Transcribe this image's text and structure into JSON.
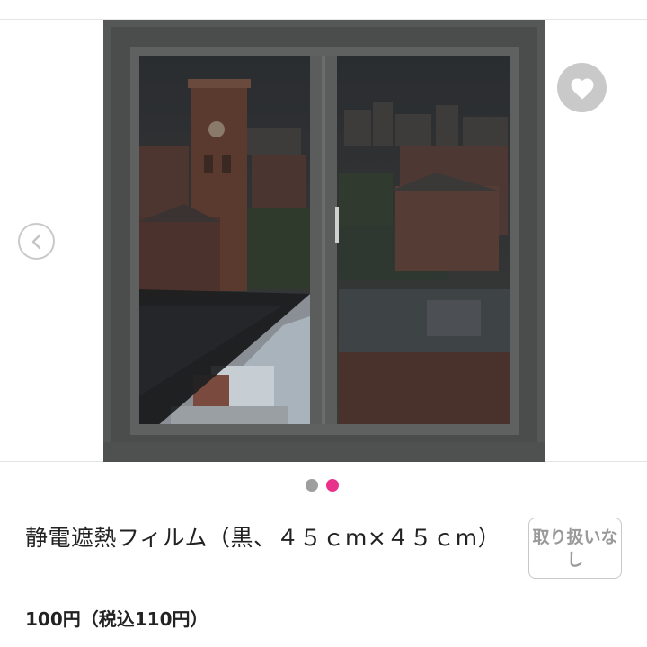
{
  "colors": {
    "accent_dot": "#e8318a",
    "inactive_dot": "#9e9e9e",
    "icon_gray": "#c9c9c9",
    "window_frame": "#4a4d4c"
  },
  "gallery": {
    "prev_icon": "chevron-left-icon",
    "favorite_icon": "heart-icon",
    "slide_count": 2,
    "active_slide": 2
  },
  "product": {
    "title": "静電遮熱フィルム（黒、４５ｃm×４５ｃm）",
    "badge": "取り扱いなし",
    "price": "100円（税込110円）"
  }
}
